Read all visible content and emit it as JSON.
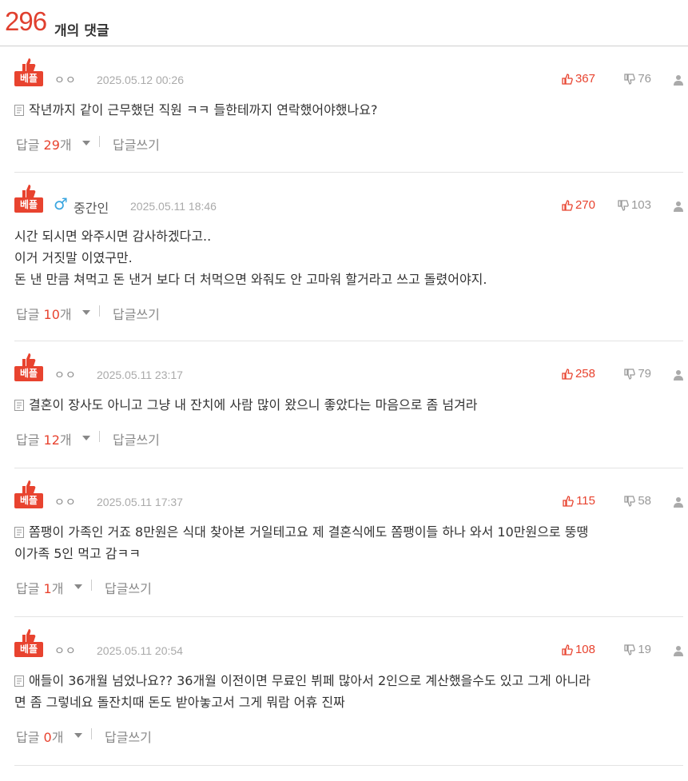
{
  "header": {
    "count": "296",
    "suffix": "개의 댓글"
  },
  "best_label": "베플",
  "colors": {
    "accent": "#e8432f",
    "male": "#3aa6e0"
  },
  "comments": [
    {
      "nick": "ㅇㅇ",
      "date": "2025.05.12 00:26",
      "up": "367",
      "down": "76",
      "lines": [
        "작년까지 같이 근무했던 직원 ㅋㅋ 들한테까지 연락했어야했나요?"
      ],
      "reply_label": "답글",
      "reply_count": "29",
      "reply_unit": "개",
      "write_label": "답글쓰기"
    },
    {
      "nick": "중간인",
      "gender": "♂",
      "date": "2025.05.11 18:46",
      "up": "270",
      "down": "103",
      "lines": [
        "시간 되시면 와주시면 감사하겠다고..",
        "이거 거짓말 이였구만.",
        "돈 낸 만큼 쳐먹고 돈 낸거 보다 더 처먹으면 와줘도 안 고마워 할거라고 쓰고 돌렸어야지."
      ],
      "reply_label": "답글",
      "reply_count": "10",
      "reply_unit": "개",
      "write_label": "답글쓰기"
    },
    {
      "nick": "ㅇㅇ",
      "date": "2025.05.11 23:17",
      "up": "258",
      "down": "79",
      "lines": [
        "결혼이 장사도 아니고 그냥 내 잔치에 사람 많이 왔으니 좋았다는 마음으로 좀 넘겨라"
      ],
      "reply_label": "답글",
      "reply_count": "12",
      "reply_unit": "개",
      "write_label": "답글쓰기"
    },
    {
      "nick": "ㅇㅇ",
      "date": "2025.05.11 17:37",
      "up": "115",
      "down": "58",
      "lines": [
        "쫌팽이 가족인 거죠 8만원은 식대 찾아본 거일테고요 제 결혼식에도 쫌팽이들 하나 와서 10만원으로 뚱땡",
        "이가족 5인 먹고 감ㅋㅋ"
      ],
      "reply_label": "답글",
      "reply_count": "1",
      "reply_unit": "개",
      "write_label": "답글쓰기"
    },
    {
      "nick": "ㅇㅇ",
      "date": "2025.05.11 20:54",
      "up": "108",
      "down": "19",
      "lines": [
        "애들이 36개월 넘었나요?? 36개월 이전이면 무료인 뷔페 많아서 2인으로 계산했을수도 있고 그게 아니라",
        "면 좀 그렇네요 돌잔치때 돈도 받아놓고서 그게 뭐람 어휴 진짜"
      ],
      "reply_label": "답글",
      "reply_count": "0",
      "reply_unit": "개",
      "write_label": "답글쓰기"
    }
  ]
}
